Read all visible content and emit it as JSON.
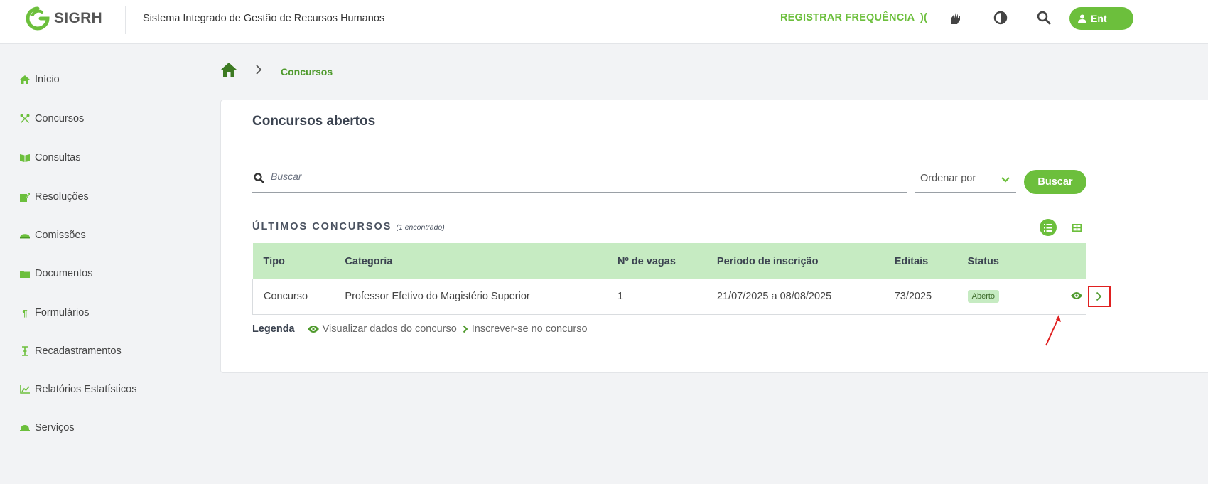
{
  "header": {
    "logo_text": "SIGRH",
    "system_name": "Sistema Integrado de Gestão de Recursos Humanos",
    "register_frequency": "REGISTRAR FREQUÊNCIA",
    "enter_label": "Ent",
    "brand_color": "#6cbf3c",
    "icons": [
      "wifi-signal-icon",
      "sign-language-icon",
      "contrast-icon",
      "search-icon",
      "user-icon"
    ]
  },
  "sidebar": {
    "items": [
      {
        "label": "Início",
        "icon": "home-icon"
      },
      {
        "label": "Concursos",
        "icon": "tools-icon"
      },
      {
        "label": "Consultas",
        "icon": "book-icon"
      },
      {
        "label": "Resoluções",
        "icon": "edit-document-icon"
      },
      {
        "label": "Comissões",
        "icon": "people-icon"
      },
      {
        "label": "Documentos",
        "icon": "folder-icon"
      },
      {
        "label": "Formulários",
        "icon": "paragraph-icon"
      },
      {
        "label": "Recadastramentos",
        "icon": "text-cursor-icon"
      },
      {
        "label": "Relatórios Estatísticos",
        "icon": "chart-line-icon"
      },
      {
        "label": "Serviços",
        "icon": "service-bell-icon"
      }
    ]
  },
  "breadcrumb": {
    "home_icon": "home-icon",
    "current": "Concursos"
  },
  "main": {
    "card_title": "Concursos abertos",
    "search": {
      "placeholder": "Buscar",
      "value": ""
    },
    "order_by": "Ordenar por",
    "search_button": "Buscar",
    "section_title": "ÚLTIMOS CONCURSOS",
    "found_count": "(1 encontrado)",
    "table": {
      "columns": [
        "Tipo",
        "Categoria",
        "Nº de vagas",
        "Período de inscrição",
        "Editais",
        "Status"
      ],
      "rows": [
        {
          "tipo": "Concurso",
          "categoria": "Professor Efetivo do Magistério Superior",
          "vagas": "1",
          "periodo": "21/07/2025 a 08/08/2025",
          "editais": "73/2025",
          "status": "Aberto"
        }
      ]
    },
    "legend": {
      "label": "Legenda",
      "view": "Visualizar dados do concurso",
      "enroll": "Inscrever-se no concurso"
    }
  }
}
